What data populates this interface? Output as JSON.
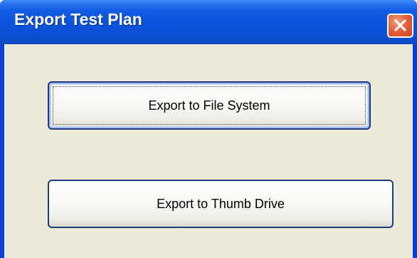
{
  "window": {
    "title": "Export Test Plan",
    "close_icon": "close-icon"
  },
  "buttons": {
    "export_file_system": "Export to File System",
    "export_thumb_drive": "Export to Thumb Drive"
  },
  "colors": {
    "titlebar": "#0a54db",
    "client_background": "#ece9d8",
    "close_button": "#e3623f",
    "button_border": "#1f3c80"
  }
}
